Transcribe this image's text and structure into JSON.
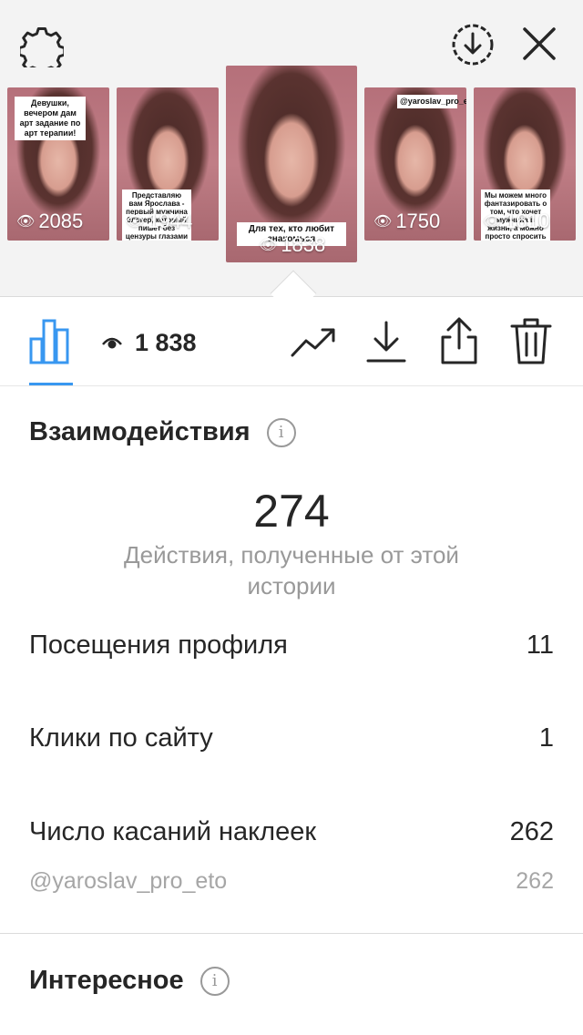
{
  "top_bar": {
    "settings_icon": "gear-icon",
    "download_icon": "download-circle-icon",
    "close_icon": "close-icon"
  },
  "stories": [
    {
      "caption": "Девушки, вечером дам арт задание по арт терапии!",
      "views": "2085"
    },
    {
      "caption": "Представляю вам Ярослава - первый мужчина блогер, который пишет без цензуры глазами мужчины",
      "views": "1944"
    },
    {
      "caption": "Для тех, кто любит знакомься",
      "views": "1838"
    },
    {
      "caption": "@yaroslav_pro_eto",
      "views": "1750"
    },
    {
      "caption": "Мы можем много фантазировать о том, что хочет мужчина в жизни, а можно просто спросить у Ярослава",
      "views": "1610"
    }
  ],
  "toolbar": {
    "view_count": "1 838",
    "icons": [
      "bar-chart-icon",
      "eye-icon",
      "trend-icon",
      "download-icon",
      "share-icon",
      "trash-icon"
    ]
  },
  "interactions": {
    "title": "Взаимодействия",
    "total": "274",
    "total_desc": "Действия, полученные от этой истории",
    "rows": [
      {
        "label": "Посещения профиля",
        "value": "11"
      },
      {
        "label": "Клики по сайту",
        "value": "1"
      },
      {
        "label": "Число касаний наклеек",
        "value": "262"
      }
    ],
    "sub_row": {
      "label": "@yaroslav_pro_eto",
      "value": "262"
    }
  },
  "discovery": {
    "title": "Интересное"
  },
  "colors": {
    "accent": "#3897f0",
    "text": "#262626",
    "muted": "#999999"
  }
}
